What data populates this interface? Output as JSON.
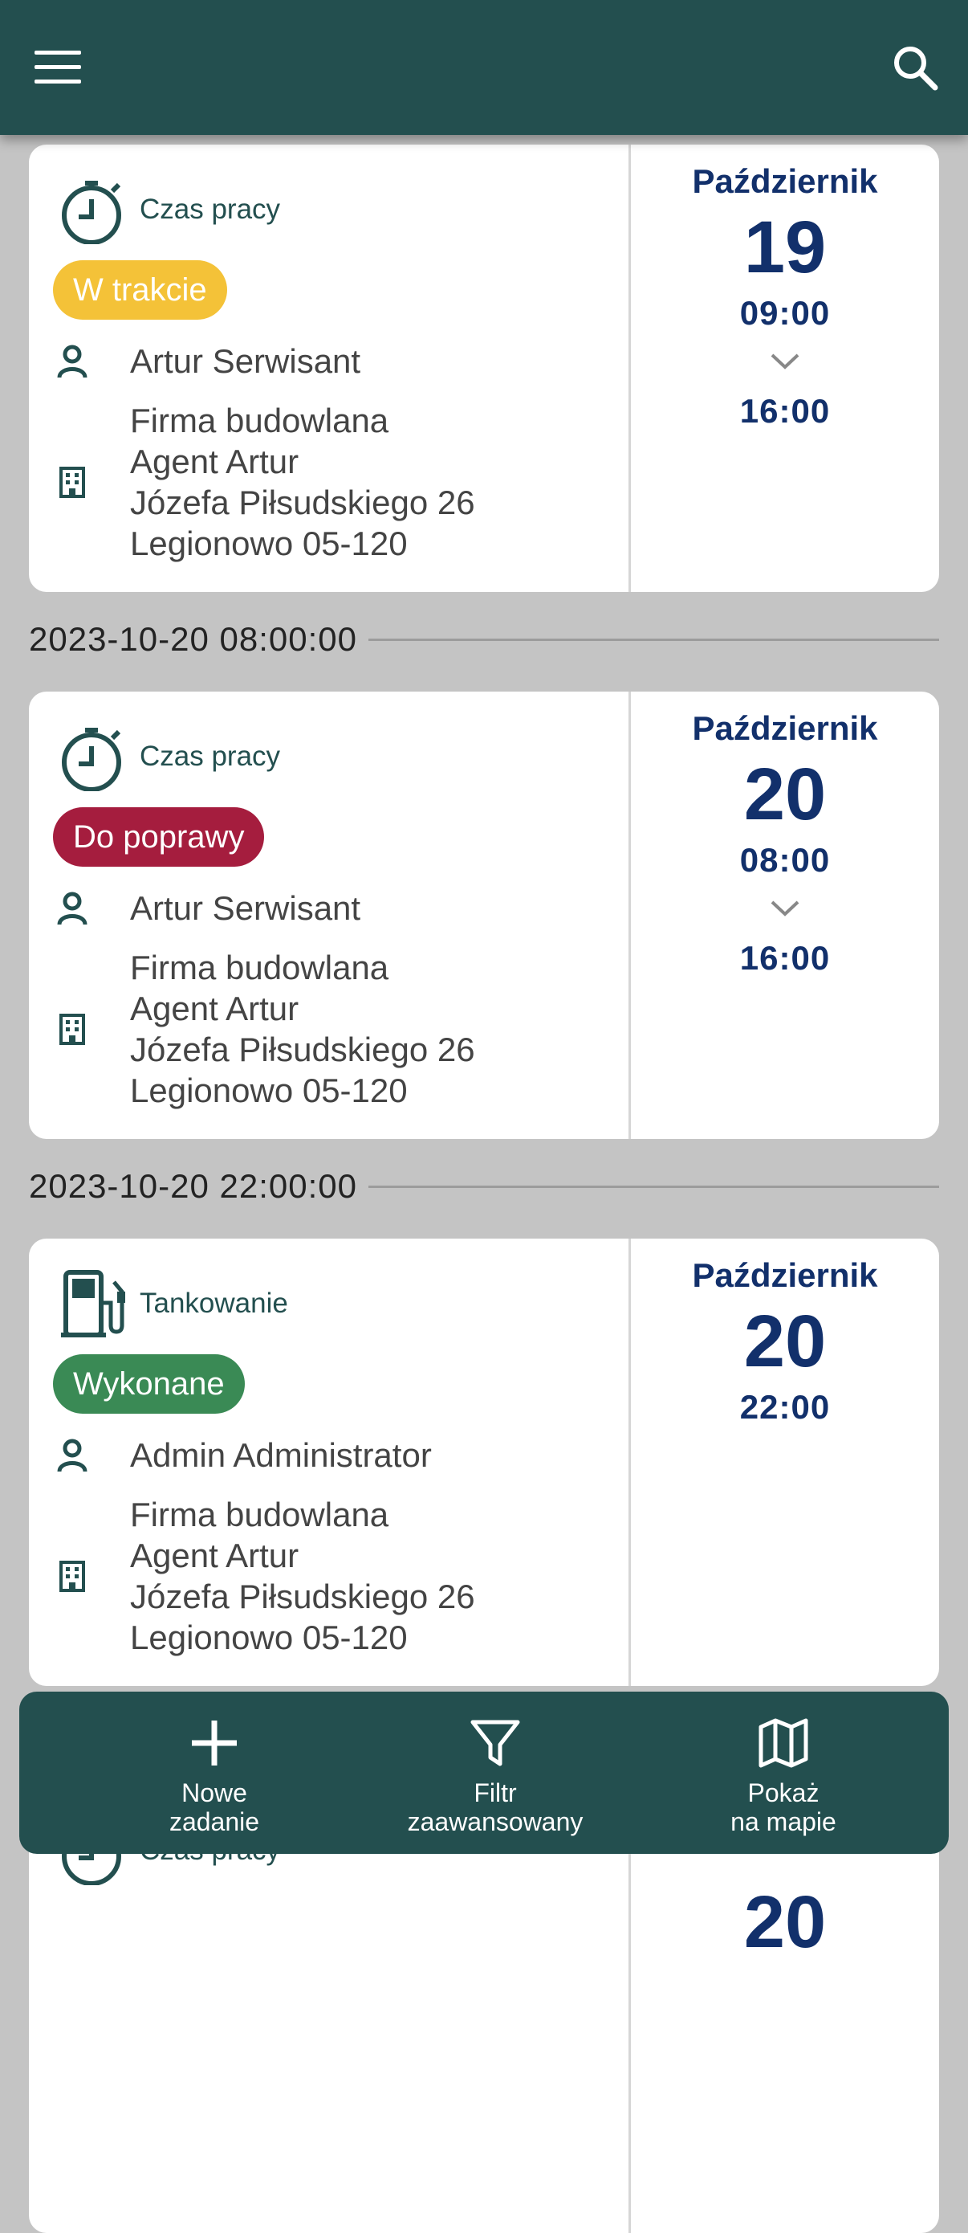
{
  "appbar": {
    "menu_icon": "hamburger-menu-icon",
    "search_icon": "search-icon"
  },
  "cards": [
    {
      "type_label": "Czas pracy",
      "type_icon": "stopwatch-icon",
      "status": "W trakcie",
      "status_color": "#f4c238",
      "person": "Artur Serwisant",
      "address": [
        "Firma budowlana",
        "Agent Artur",
        "Józefa Piłsudskiego 26",
        "Legionowo 05-120"
      ],
      "month": "Październik",
      "day": "19",
      "time_start": "09:00",
      "time_end": "16:00"
    },
    {
      "type_label": "Czas pracy",
      "type_icon": "stopwatch-icon",
      "status": "Do poprawy",
      "status_color": "#a51d3e",
      "person": "Artur Serwisant",
      "address": [
        "Firma budowlana",
        "Agent Artur",
        "Józefa Piłsudskiego 26",
        "Legionowo 05-120"
      ],
      "month": "Październik",
      "day": "20",
      "time_start": "08:00",
      "time_end": "16:00"
    },
    {
      "type_label": "Tankowanie",
      "type_icon": "fuel-pump-icon",
      "status": "Wykonane",
      "status_color": "#3a8a55",
      "person": "Admin Administrator",
      "address": [
        "Firma budowlana",
        "Agent Artur",
        "Józefa Piłsudskiego 26",
        "Legionowo 05-120"
      ],
      "month": "Październik",
      "day": "20",
      "time_start": "22:00",
      "time_end": ""
    },
    {
      "type_label": "Czas pracy",
      "type_icon": "stopwatch-icon",
      "day": "20"
    }
  ],
  "separators": [
    "2023-10-20 08:00:00",
    "2023-10-20 22:00:00"
  ],
  "bottom_bar": {
    "new_task": [
      "Nowe",
      "zadanie"
    ],
    "advanced_filter": [
      "Filtr",
      "zaawansowany"
    ],
    "show_map": [
      "Pokaż",
      "na mapie"
    ]
  },
  "colors": {
    "primary": "#234f4f",
    "date_text": "#12306b",
    "background": "#c4c4c4"
  }
}
